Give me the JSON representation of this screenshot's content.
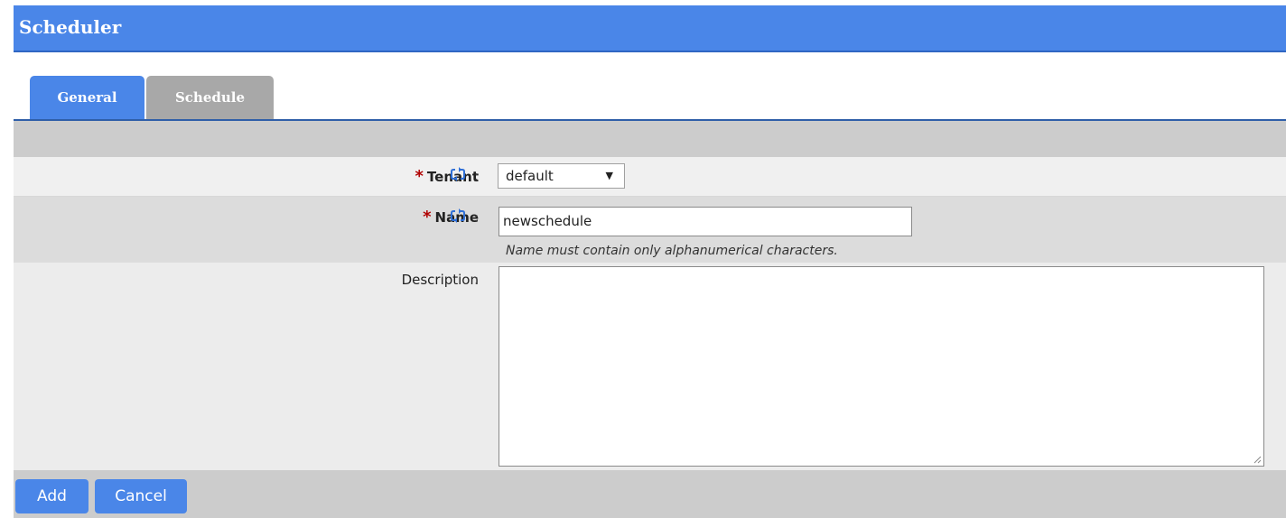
{
  "app": {
    "title": "Scheduler"
  },
  "tabs": [
    {
      "label": "General",
      "active": true
    },
    {
      "label": "Schedule",
      "active": false
    }
  ],
  "form": {
    "tenant": {
      "required_mark": "*",
      "label": "Tenant",
      "colon": ":",
      "value": "default",
      "refresh_icon": "refresh-icon"
    },
    "name": {
      "required_mark": "*",
      "label": "Name",
      "colon": ":",
      "value": "newschedule",
      "hint": "Name must contain only alphanumerical characters.",
      "refresh_icon": "refresh-icon"
    },
    "description": {
      "label": "Description",
      "colon": ":",
      "value": ""
    }
  },
  "footer": {
    "add_label": "Add",
    "cancel_label": "Cancel"
  },
  "colors": {
    "accent": "#4a86e8",
    "required": "#b00000",
    "inactive_tab": "#a8a8a8"
  }
}
